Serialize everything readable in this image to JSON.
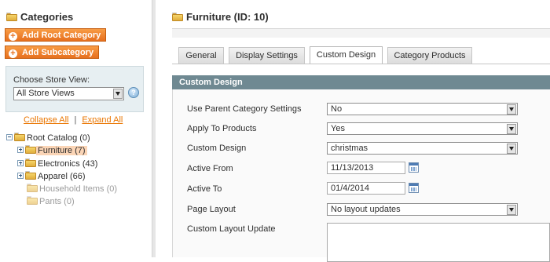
{
  "sidebar": {
    "title": "Categories",
    "add_root_label": "Add Root Category",
    "add_sub_label": "Add Subcategory",
    "store_view_label": "Choose Store View:",
    "store_view_value": "All Store Views",
    "collapse_all": "Collapse All",
    "separator": "|",
    "expand_all": "Expand All",
    "tree": [
      {
        "label": "Root Catalog (0)"
      },
      {
        "label": "Furniture (7)",
        "selected": true
      },
      {
        "label": "Electronics (43)"
      },
      {
        "label": "Apparel (66)"
      },
      {
        "label": "Household Items (0)",
        "disabled": true
      },
      {
        "label": "Pants (0)",
        "disabled": true
      }
    ]
  },
  "main": {
    "title": "Furniture (ID: 10)",
    "tabs": [
      {
        "label": "General"
      },
      {
        "label": "Display Settings"
      },
      {
        "label": "Custom Design",
        "active": true
      },
      {
        "label": "Category Products"
      }
    ],
    "section_title": "Custom Design",
    "fields": {
      "use_parent": {
        "label": "Use Parent Category Settings",
        "value": "No"
      },
      "apply_products": {
        "label": "Apply To Products",
        "value": "Yes"
      },
      "custom_design": {
        "label": "Custom Design",
        "value": "christmas"
      },
      "active_from": {
        "label": "Active From",
        "value": "11/13/2013"
      },
      "active_to": {
        "label": "Active To",
        "value": "01/4/2014"
      },
      "page_layout": {
        "label": "Page Layout",
        "value": "No layout updates"
      },
      "layout_update": {
        "label": "Custom Layout Update",
        "value": ""
      }
    }
  },
  "colors": {
    "accent_orange": "#e7701e",
    "section_header": "#6f8992",
    "selected_node": "#fbd5b6",
    "link": "#ea7601"
  }
}
